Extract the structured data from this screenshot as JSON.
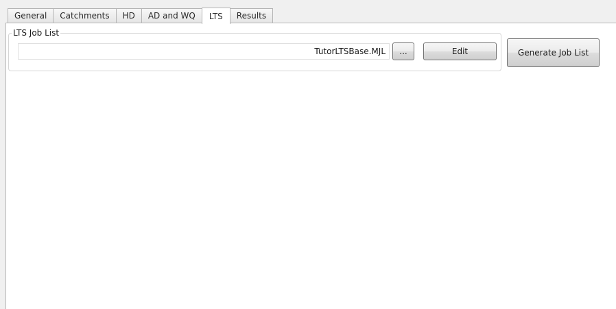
{
  "tabs": [
    {
      "label": "General",
      "active": false
    },
    {
      "label": "Catchments",
      "active": false
    },
    {
      "label": "HD",
      "active": false
    },
    {
      "label": "AD and WQ",
      "active": false
    },
    {
      "label": "LTS",
      "active": true
    },
    {
      "label": "Results",
      "active": false
    }
  ],
  "lts_group": {
    "title": "LTS Job List",
    "job_list_file": "TutorLTSBase.MJL",
    "browse_label": "...",
    "edit_label": "Edit"
  },
  "generate_label": "Generate Job List"
}
